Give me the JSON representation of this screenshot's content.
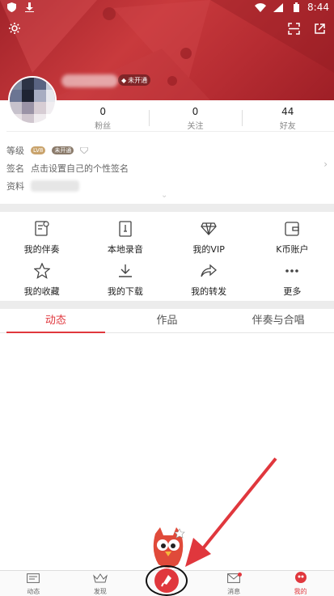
{
  "status_bar": {
    "time": "8:44"
  },
  "header": {
    "badge_text": "未开通",
    "stats": [
      {
        "value": "0",
        "label": "粉丝"
      },
      {
        "value": "0",
        "label": "关注"
      },
      {
        "value": "44",
        "label": "好友"
      }
    ]
  },
  "profile": {
    "level_label": "等级",
    "level_badge": "LV8",
    "level_badge2": "未开通",
    "signature_label": "签名",
    "signature_text": "点击设置自己的个性签名",
    "info_label": "资料"
  },
  "grid": {
    "items": [
      {
        "label": "我的伴奏"
      },
      {
        "label": "本地录音"
      },
      {
        "label": "我的VIP"
      },
      {
        "label": "K币账户"
      },
      {
        "label": "我的收藏"
      },
      {
        "label": "我的下载"
      },
      {
        "label": "我的转发"
      },
      {
        "label": "更多"
      }
    ]
  },
  "tabs": [
    {
      "label": "动态"
    },
    {
      "label": "作品"
    },
    {
      "label": "伴奏与合唱"
    }
  ],
  "bottom_nav": [
    {
      "label": "动态"
    },
    {
      "label": "发现"
    },
    {
      "label": "消息"
    },
    {
      "label": "我的"
    }
  ],
  "colors": {
    "accent": "#e0373d",
    "hero": "#b62c32"
  }
}
